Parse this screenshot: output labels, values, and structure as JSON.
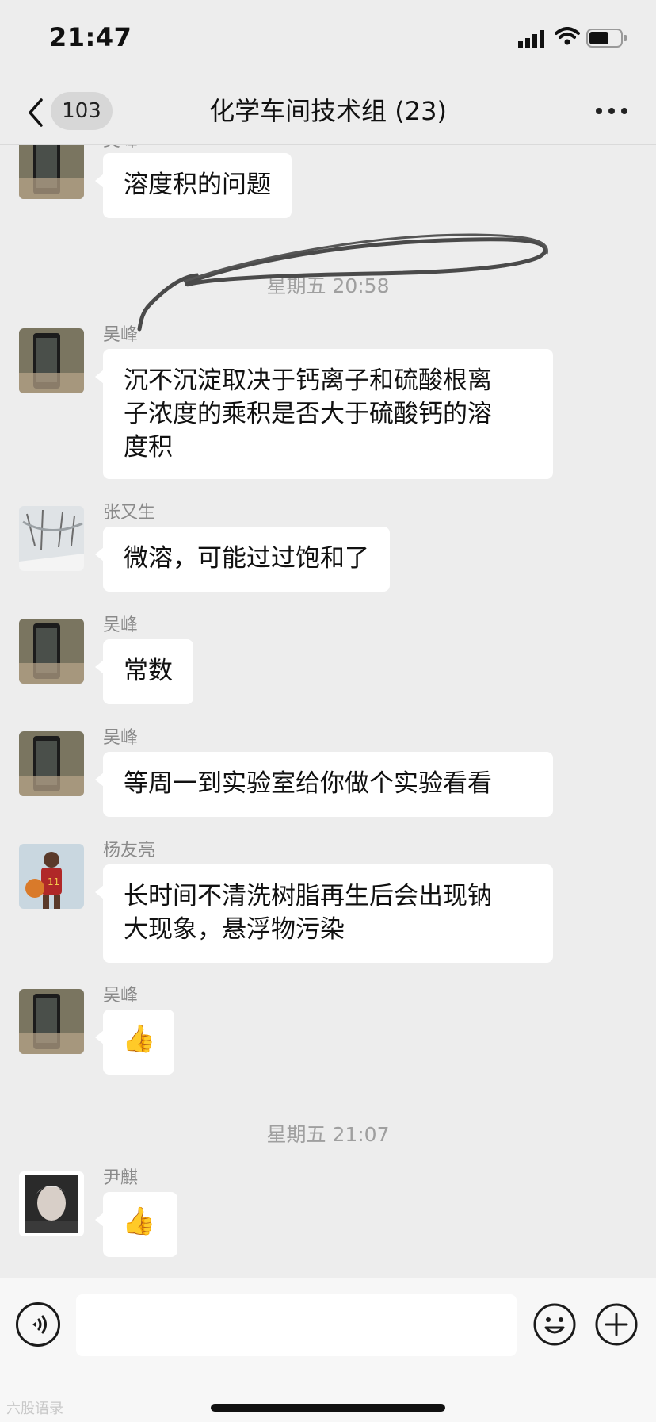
{
  "status_bar": {
    "time": "21:47"
  },
  "nav": {
    "back_count": "103",
    "title": "化学车间技术组 (23)"
  },
  "messages": [
    {
      "sender": "吴峰",
      "text": "溶度积的问题"
    },
    {
      "timestamp": "星期五 20:58"
    },
    {
      "sender": "吴峰",
      "lines": [
        "沉不沉淀取决于钙离子和硫酸根离",
        "子浓度的乘积是否大于硫酸钙的溶",
        "度积"
      ]
    },
    {
      "sender": "张又生",
      "text": "微溶，可能过过饱和了"
    },
    {
      "sender": "吴峰",
      "text": "常数"
    },
    {
      "sender": "吴峰",
      "text": "等周一到实验室给你做个实验看看"
    },
    {
      "sender": "杨友亮",
      "lines": [
        "长时间不清洗树脂再生后会出现钠",
        "大现象，悬浮物污染"
      ]
    },
    {
      "sender": "吴峰",
      "emoji": "👍"
    },
    {
      "timestamp": "星期五 21:07"
    },
    {
      "sender": "尹麒",
      "emoji": "👍"
    }
  ],
  "watermark": "六股语录",
  "colors": {
    "background": "#ededed",
    "bubble": "#ffffff",
    "sender": "#8a8a8a",
    "timestamp": "#9f9f9f"
  },
  "icons": [
    "back-chevron-icon",
    "more-icon",
    "voice-icon",
    "emoji-icon",
    "plus-icon"
  ]
}
